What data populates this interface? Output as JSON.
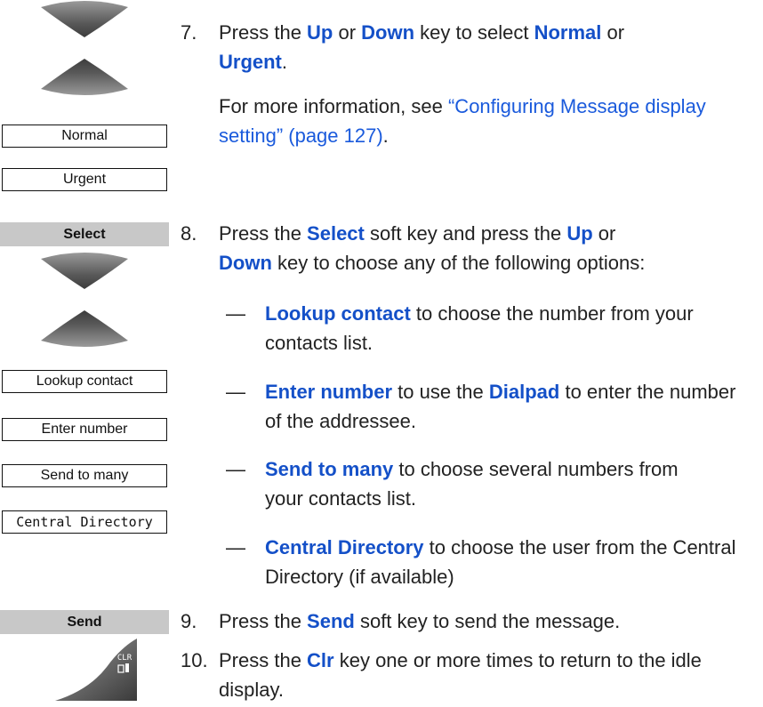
{
  "step7": {
    "number": "7.",
    "text_a": "Press the ",
    "up": "Up",
    "text_b": " or ",
    "down": "Down",
    "text_c": " key to select ",
    "normal": "Normal",
    "text_d": " or",
    "urgent": "Urgent",
    "text_e": ".",
    "info_a": "For more information, see ",
    "info_link": "“Configuring Message display setting” (page 127)",
    "info_b": ".",
    "box_normal": "Normal",
    "box_urgent": "Urgent"
  },
  "step8": {
    "number": "8.",
    "softkey": "Select",
    "text_a": "Press the ",
    "select": "Select",
    "text_b": " soft key and press the ",
    "up": "Up",
    "text_c": " or",
    "down": "Down",
    "text_d": " key to choose any of the following options:",
    "dash": "—",
    "options": [
      {
        "box": "Lookup contact",
        "kw": "Lookup contact",
        "rest": " to choose the number from your contacts list."
      },
      {
        "box": "Enter number",
        "kw": "Enter number",
        "mid": " to use the ",
        "kw2": "Dialpad",
        "rest": " to enter the number of the addressee."
      },
      {
        "box": "Send to many",
        "kw": "Send to many",
        "rest": " to choose several numbers from your contacts list."
      },
      {
        "box": "Central Directory",
        "kw": "Central Directory",
        "rest": " to choose the user from the Central Directory (if available)"
      }
    ]
  },
  "step9": {
    "number": "9.",
    "softkey": "Send",
    "text_a": "Press the ",
    "send": "Send",
    "text_b": " soft key to send the message."
  },
  "step10": {
    "number": "10.",
    "key_label_top": "CLR",
    "text_a": "Press the ",
    "clr": "Clr",
    "text_b": " key one or more times to return to the idle display."
  },
  "colors": {
    "keyword": "#1450c8",
    "link": "#1a5adc",
    "softkey_bg": "#c8c8c8"
  }
}
